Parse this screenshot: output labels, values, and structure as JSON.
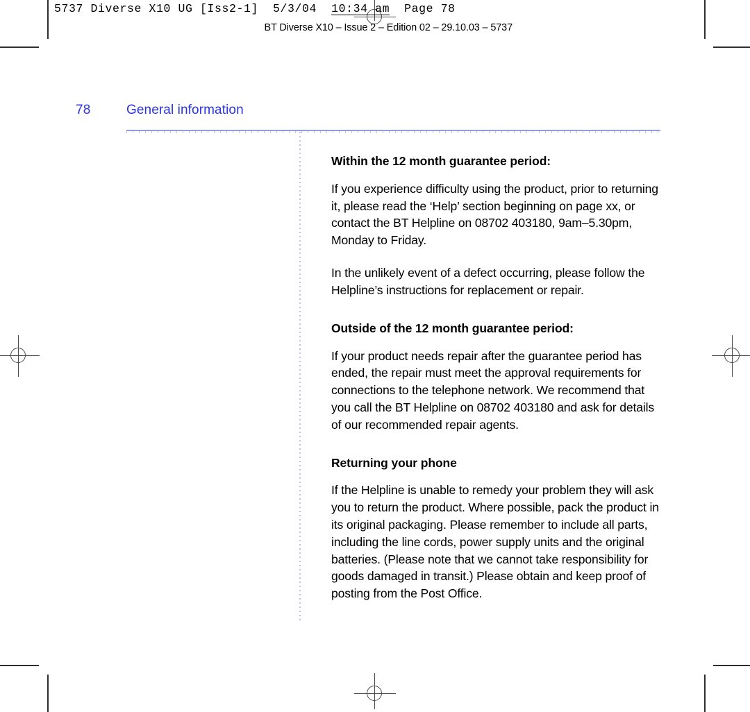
{
  "print_marks": {
    "slugline": "5737 Diverse X10 UG [Iss2-1]  5/3/04  ",
    "slug_time": "10:34 am",
    "slug_tail": "  Page 78",
    "jobline": "BT Diverse X10 – Issue 2 – Edition 02 – 29.10.03 – 5737",
    "accent_color": "#4a4a4a"
  },
  "page": {
    "folio": "78",
    "running_head": "General information",
    "accent_color": "#2a34e0",
    "rule_color": "#8f9bf2"
  },
  "sections": [
    {
      "heading": "Within the 12 month guarantee period:",
      "paragraphs": [
        "If you experience difficulty using the product, prior to returning it, please read the ‘Help’ section beginning on page xx, or contact the BT Helpline on 08702 403180, 9am–5.30pm, Monday to Friday.",
        "In the unlikely event of a defect occurring, please follow the Helpline’s instructions for replacement or repair."
      ]
    },
    {
      "heading": "Outside of the 12 month guarantee period:",
      "paragraphs": [
        "If your product needs repair after the guarantee period has ended, the repair must meet the approval requirements for connections to the telephone network. We recommend that you call the BT Helpline on 08702 403180 and ask for details of our recommended repair agents."
      ]
    },
    {
      "heading": "Returning your phone",
      "paragraphs": [
        "If the Helpline is unable to remedy your problem they will ask you to return the product. Where possible, pack the product in its original packaging. Please remember to include all parts, including the line cords, power supply units and the original batteries. (Please note that we cannot take responsibility for goods damaged in transit.) Please obtain and keep proof of posting from the Post Office."
      ]
    }
  ]
}
